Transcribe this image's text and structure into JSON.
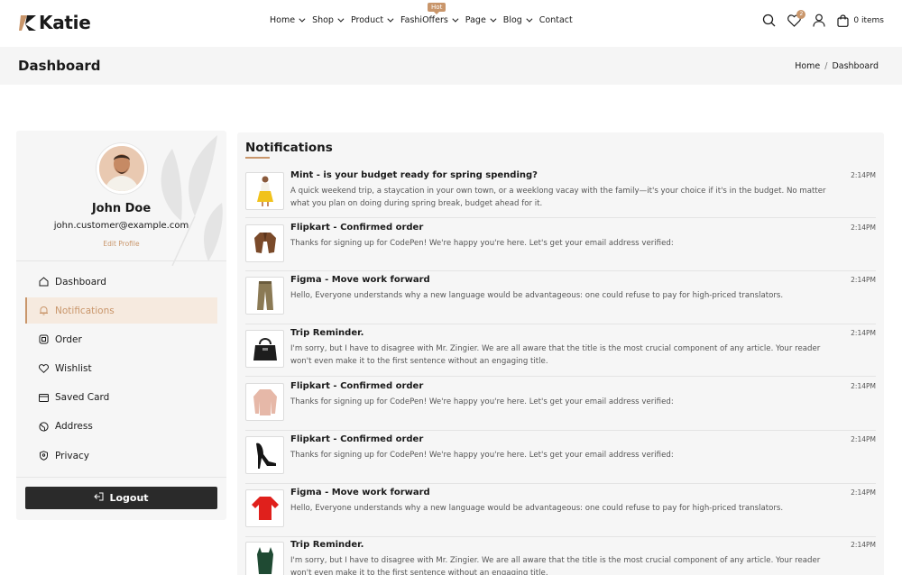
{
  "header": {
    "logo_text": "Katie",
    "nav": [
      {
        "label": "Home",
        "has_dropdown": true
      },
      {
        "label": "Shop",
        "has_dropdown": true
      },
      {
        "label": "Product",
        "has_dropdown": true
      },
      {
        "label": "FashiOffers",
        "has_dropdown": true,
        "badge": "Hot"
      },
      {
        "label": "Page",
        "has_dropdown": true
      },
      {
        "label": "Blog",
        "has_dropdown": true
      },
      {
        "label": "Contact",
        "has_dropdown": false
      }
    ],
    "wishlist_count": "2",
    "cart_text": "0 items",
    "icons": [
      "search-icon",
      "heart-icon",
      "user-icon",
      "bag-icon"
    ]
  },
  "titlebar": {
    "title": "Dashboard",
    "breadcrumb": [
      "Home",
      "Dashboard"
    ],
    "separator": "/"
  },
  "sidebar": {
    "name": "John Doe",
    "email": "john.customer@example.com",
    "edit_profile": "Edit Profile",
    "menu": [
      {
        "label": "Dashboard",
        "icon": "home-icon",
        "active": false
      },
      {
        "label": "Notifications",
        "icon": "bell-icon",
        "active": true
      },
      {
        "label": "Order",
        "icon": "box-icon",
        "active": false
      },
      {
        "label": "Wishlist",
        "icon": "heart-icon",
        "active": false
      },
      {
        "label": "Saved Card",
        "icon": "card-icon",
        "active": false
      },
      {
        "label": "Address",
        "icon": "globe-icon",
        "active": false
      },
      {
        "label": "Privacy",
        "icon": "shield-icon",
        "active": false
      }
    ],
    "logout": "Logout"
  },
  "notifications": {
    "heading": "Notifications",
    "items": [
      {
        "title": "Mint - is your budget ready for spring spending?",
        "body": "A quick weekend trip, a staycation in your own town, or a weeklong vacay with the family—it's your choice if it's in the budget. No matter what you plan on doing during spring break, budget ahead for it.",
        "time": "2:14PM",
        "thumb": "woman-yellow-skirt"
      },
      {
        "title": "Flipkart - Confirmed order",
        "body": "Thanks for signing up for CodePen! We're happy you're here. Let's get your email address verified:",
        "time": "2:14PM",
        "thumb": "brown-jacket"
      },
      {
        "title": "Figma - Move work forward",
        "body": "Hello, Everyone understands why a new language would be advantageous: one could refuse to pay for high-priced translators.",
        "time": "2:14PM",
        "thumb": "cargo-pants"
      },
      {
        "title": "Trip Reminder.",
        "body": "I'm sorry, but I have to disagree with Mr. Zingier. We are all aware that the title is the most crucial component of any article. Your reader won't even make it to the first sentence without an engaging title.",
        "time": "2:14PM",
        "thumb": "black-handbag"
      },
      {
        "title": "Flipkart - Confirmed order",
        "body": "Thanks for signing up for CodePen! We're happy you're here. Let's get your email address verified:",
        "time": "2:14PM",
        "thumb": "pink-sweater"
      },
      {
        "title": "Flipkart - Confirmed order",
        "body": "Thanks for signing up for CodePen! We're happy you're here. Let's get your email address verified:",
        "time": "2:14PM",
        "thumb": "black-heels"
      },
      {
        "title": "Figma - Move work forward",
        "body": "Hello, Everyone understands why a new language would be advantageous: one could refuse to pay for high-priced translators.",
        "time": "2:14PM",
        "thumb": "red-top"
      },
      {
        "title": "Trip Reminder.",
        "body": "I'm sorry, but I have to disagree with Mr. Zingier. We are all aware that the title is the most crucial component of any article. Your reader won't even make it to the first sentence without an engaging title.",
        "time": "2:14PM",
        "thumb": "green-top"
      }
    ]
  },
  "colors": {
    "accent": "#c9966b",
    "dark": "#2a2a2a",
    "panel_bg": "#f6f6f6"
  }
}
